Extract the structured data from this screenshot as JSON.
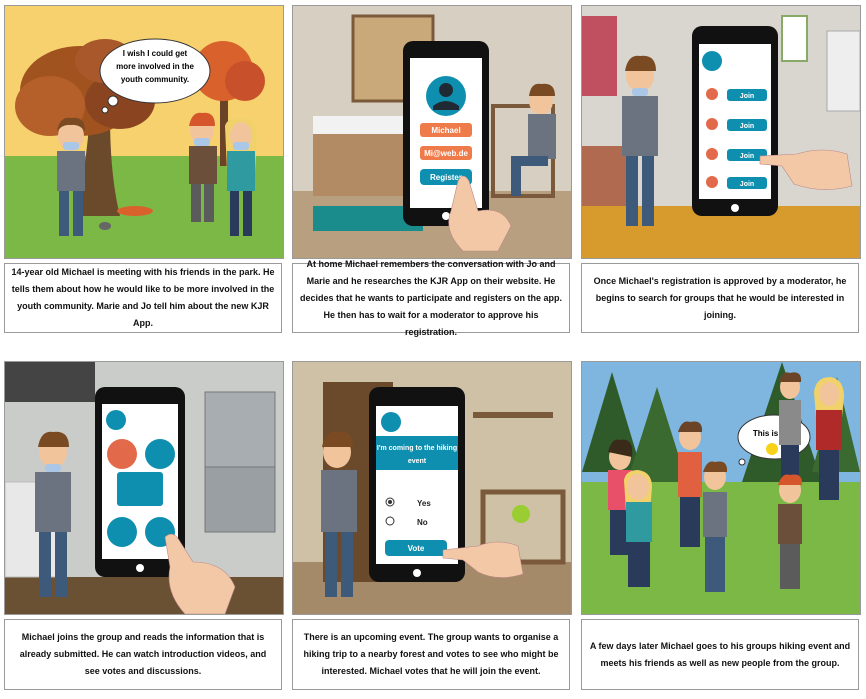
{
  "panels": [
    {
      "id": 1,
      "caption": "14-year old Michael is meeting with his friends in the park. He tells them about how he would like to be more involved in the youth community. Marie and Jo tell him about the new KJR App.",
      "bubble": [
        "I wish I could get",
        "more involved in the",
        "youth community."
      ]
    },
    {
      "id": 2,
      "caption": "At home Michael remembers the conversation with Jo and Marie and he researches the KJR App on their website. He decides that he wants to participate and registers on the app.  He then has to wait for a moderator to approve his registration.",
      "phone": {
        "name_field": "Michael",
        "email_field": "Mi@web.de",
        "register_button": "Register"
      }
    },
    {
      "id": 3,
      "caption": "Once Michael's registration is approved by a moderator, he begins to search for groups that he would be interested in joining.",
      "phone": {
        "join_buttons": [
          "Join",
          "Join",
          "Join",
          "Join"
        ]
      }
    },
    {
      "id": 4,
      "caption": "Michael joins the group and reads the information that is already submitted. He can watch introduction videos, and see votes and discussions."
    },
    {
      "id": 5,
      "caption": "There is an upcoming event. The group wants to organise a hiking trip to a nearby forest and votes to see who might be interested. Michael votes that he will join the event.",
      "phone": {
        "event_line1": "I'm coming to the hiking",
        "event_line2": "event",
        "option_yes": "Yes",
        "option_no": "No",
        "vote_button": "Vote"
      }
    },
    {
      "id": 6,
      "caption": "A few days later Michael goes to his groups hiking event and meets his friends as well as new people from the group.",
      "bubble": "This is fun."
    }
  ],
  "colors": {
    "app_teal": "#0f8fb0",
    "field_orange": "#ef7b4a",
    "border": "#9a9a9a"
  }
}
